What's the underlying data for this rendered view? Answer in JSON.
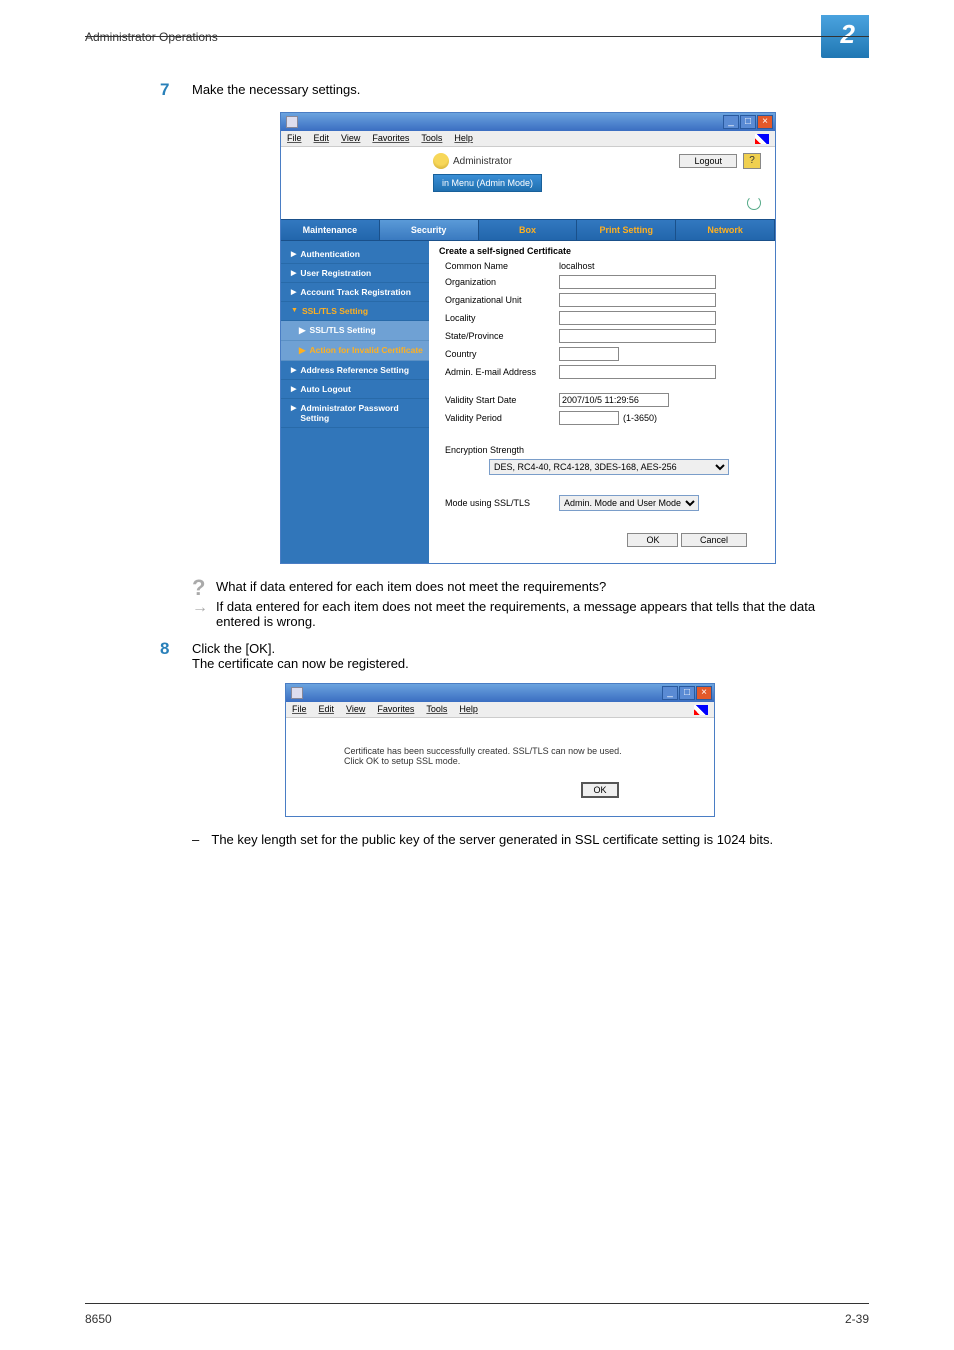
{
  "header": {
    "title": "Administrator Operations",
    "chapter": "2"
  },
  "step7": {
    "num": "7",
    "text": "Make the necessary settings."
  },
  "browser": {
    "menus": [
      "File",
      "Edit",
      "View",
      "Favorites",
      "Tools",
      "Help"
    ],
    "admin_label": "Administrator",
    "logout": "Logout",
    "admin_mode": "in Menu (Admin Mode)",
    "tabs": [
      "Maintenance",
      "Security",
      "Box",
      "Print Setting",
      "Network"
    ],
    "sidebar": {
      "items": [
        "Authentication",
        "User Registration",
        "Account Track Registration",
        "SSL/TLS Setting",
        "Address Reference Setting",
        "Auto Logout",
        "Administrator Password Setting"
      ],
      "sub": [
        "SSL/TLS Setting",
        "Action for Invalid Certificate"
      ]
    },
    "form": {
      "title": "Create a self-signed Certificate",
      "common_name_lbl": "Common Name",
      "common_name_val": "localhost",
      "organization_lbl": "Organization",
      "org_unit_lbl": "Organizational Unit",
      "locality_lbl": "Locality",
      "state_lbl": "State/Province",
      "country_lbl": "Country",
      "admin_email_lbl": "Admin. E-mail Address",
      "validity_start_lbl": "Validity Start Date",
      "validity_start_val": "2007/10/5 11:29:56",
      "validity_period_lbl": "Validity Period",
      "validity_period_hint": "(1-3650)",
      "encryption_lbl": "Encryption Strength",
      "encryption_val": "DES, RC4-40, RC4-128, 3DES-168, AES-256",
      "mode_lbl": "Mode using SSL/TLS",
      "mode_val": "Admin. Mode and User Mode",
      "ok": "OK",
      "cancel": "Cancel"
    }
  },
  "qa": {
    "q": "What if data entered for each item does not meet the requirements?",
    "a": "If data entered for each item does not meet the requirements, a message appears that tells that the data entered is wrong."
  },
  "step8": {
    "num": "8",
    "line1": "Click the [OK].",
    "line2": "The certificate can now be registered."
  },
  "ss2": {
    "msg1": "Certificate has been successfully created. SSL/TLS can now be used.",
    "msg2": "Click OK to setup SSL mode.",
    "ok": "OK"
  },
  "note": "The key length set for the public key of the server generated in SSL certificate setting is 1024 bits.",
  "footer": {
    "left": "8650",
    "right": "2-39"
  }
}
